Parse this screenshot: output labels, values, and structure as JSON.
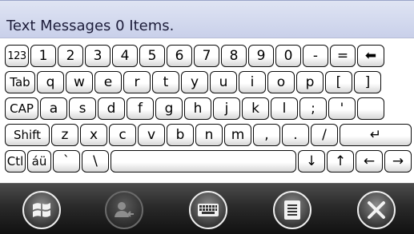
{
  "title_bar": {
    "title": "Text Messages  0 Items."
  },
  "keyboard": {
    "rows": [
      [
        {
          "id": "key-123",
          "label": "123"
        },
        {
          "id": "key-1",
          "label": "1"
        },
        {
          "id": "key-2",
          "label": "2"
        },
        {
          "id": "key-3",
          "label": "3"
        },
        {
          "id": "key-4",
          "label": "4"
        },
        {
          "id": "key-5",
          "label": "5"
        },
        {
          "id": "key-6",
          "label": "6"
        },
        {
          "id": "key-7",
          "label": "7"
        },
        {
          "id": "key-8",
          "label": "8"
        },
        {
          "id": "key-9",
          "label": "9"
        },
        {
          "id": "key-0",
          "label": "0"
        },
        {
          "id": "key-minus",
          "label": "-"
        },
        {
          "id": "key-equals",
          "label": "="
        },
        {
          "id": "key-backspace",
          "label": "⬅"
        }
      ],
      [
        {
          "id": "key-tab",
          "label": "Tab"
        },
        {
          "id": "key-q",
          "label": "q"
        },
        {
          "id": "key-w",
          "label": "w"
        },
        {
          "id": "key-e",
          "label": "e"
        },
        {
          "id": "key-r",
          "label": "r"
        },
        {
          "id": "key-t",
          "label": "t"
        },
        {
          "id": "key-y",
          "label": "y"
        },
        {
          "id": "key-u",
          "label": "u"
        },
        {
          "id": "key-i",
          "label": "i"
        },
        {
          "id": "key-o",
          "label": "o"
        },
        {
          "id": "key-p",
          "label": "p"
        },
        {
          "id": "key-left-bracket",
          "label": "["
        },
        {
          "id": "key-right-bracket",
          "label": "]"
        }
      ],
      [
        {
          "id": "key-caps",
          "label": "CAP"
        },
        {
          "id": "key-a",
          "label": "a"
        },
        {
          "id": "key-s",
          "label": "s"
        },
        {
          "id": "key-d",
          "label": "d"
        },
        {
          "id": "key-f",
          "label": "f"
        },
        {
          "id": "key-g",
          "label": "g"
        },
        {
          "id": "key-h",
          "label": "h"
        },
        {
          "id": "key-j",
          "label": "j"
        },
        {
          "id": "key-k",
          "label": "k"
        },
        {
          "id": "key-l",
          "label": "l"
        },
        {
          "id": "key-semicolon",
          "label": ";"
        },
        {
          "id": "key-apostrophe",
          "label": "'"
        },
        {
          "id": "key-enter-top",
          "label": ""
        }
      ],
      [
        {
          "id": "key-shift",
          "label": "Shift"
        },
        {
          "id": "key-z",
          "label": "z"
        },
        {
          "id": "key-x",
          "label": "x"
        },
        {
          "id": "key-c",
          "label": "c"
        },
        {
          "id": "key-v",
          "label": "v"
        },
        {
          "id": "key-b",
          "label": "b"
        },
        {
          "id": "key-n",
          "label": "n"
        },
        {
          "id": "key-m",
          "label": "m"
        },
        {
          "id": "key-comma",
          "label": ","
        },
        {
          "id": "key-period",
          "label": "."
        },
        {
          "id": "key-slash",
          "label": "/"
        },
        {
          "id": "key-enter",
          "label": "↵"
        }
      ],
      [
        {
          "id": "key-ctrl",
          "label": "Ctl"
        },
        {
          "id": "key-accents",
          "label": "áü"
        },
        {
          "id": "key-backtick",
          "label": "`"
        },
        {
          "id": "key-backslash",
          "label": "\\"
        },
        {
          "id": "key-space",
          "label": ""
        },
        {
          "id": "key-down-arrow",
          "label": "↓"
        },
        {
          "id": "key-up-arrow",
          "label": "↑"
        },
        {
          "id": "key-left-arrow",
          "label": "←"
        },
        {
          "id": "key-right-arrow",
          "label": "→"
        }
      ]
    ]
  },
  "command_bar": {
    "buttons": [
      {
        "id": "start-button",
        "icon": "windows-logo-icon",
        "enabled": true
      },
      {
        "id": "contacts-button",
        "icon": "contact-arrow-icon",
        "enabled": false
      },
      {
        "id": "keyboard-button",
        "icon": "keyboard-icon",
        "enabled": true
      },
      {
        "id": "menu-button",
        "icon": "menu-list-icon",
        "enabled": true
      },
      {
        "id": "close-button",
        "icon": "close-x-icon",
        "enabled": true
      }
    ]
  }
}
